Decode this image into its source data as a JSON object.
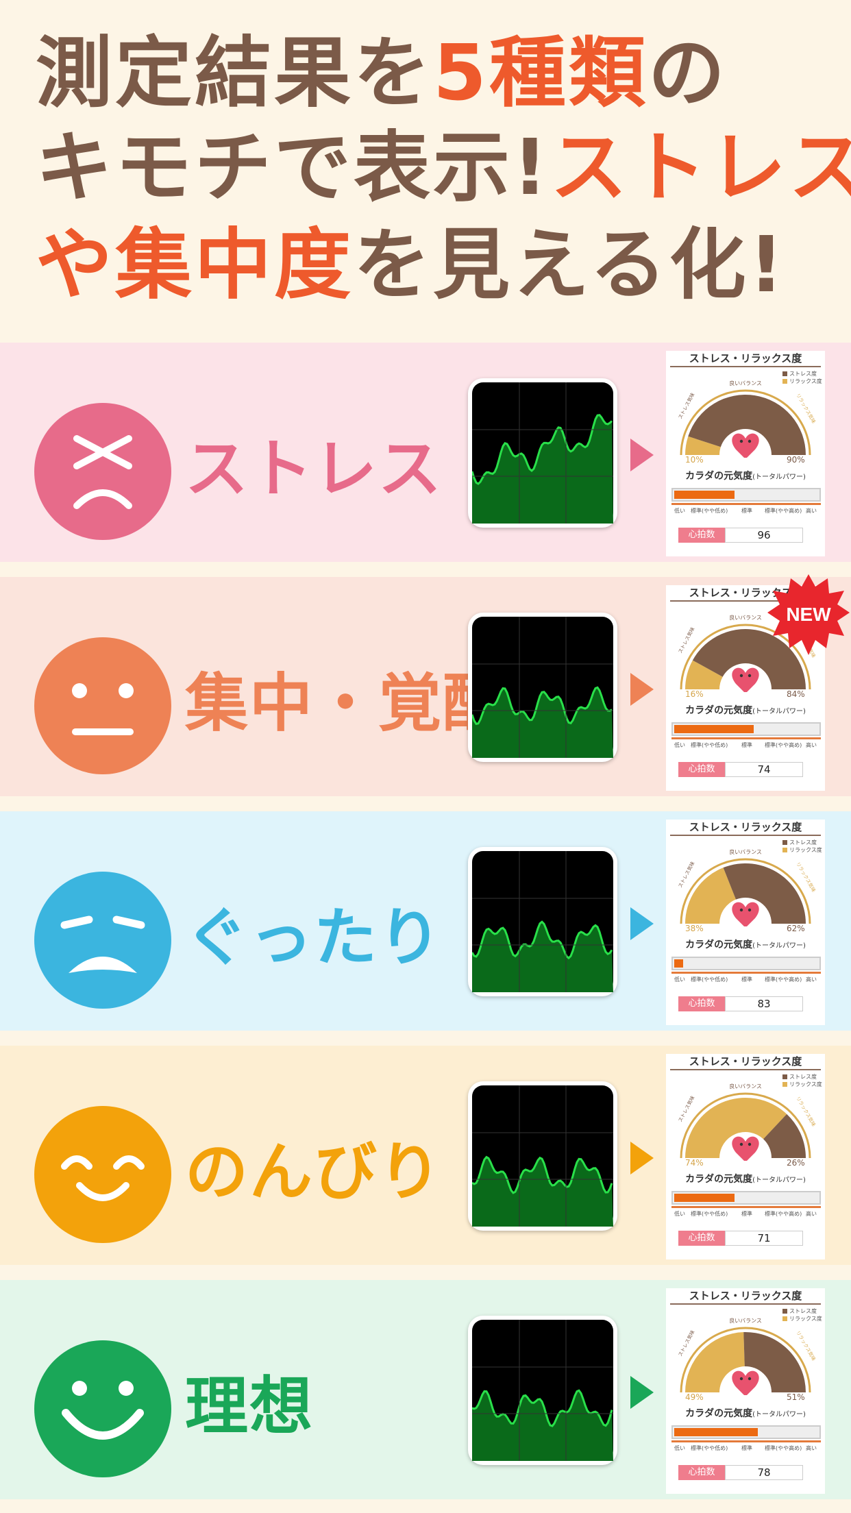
{
  "headline": {
    "line1_a": "測定結果を",
    "line1_b": "5種類",
    "line1_c": "の",
    "line2_a": "キモチで表示!",
    "line2_b": "ストレス",
    "line3_a": "や集中度",
    "line3_b": "を見える化!"
  },
  "report_labels": {
    "stress_title": "ストレス・リラックス度",
    "legend_stress": "ストレス度",
    "legend_relax": "リラックス度",
    "good_balance": "良いバランス",
    "stress_arc": "ストレス気味",
    "relax_arc": "リラックス気味",
    "body_title": "カラダの元気度",
    "body_title_small": "(トータルパワー)",
    "scale_low": "低い",
    "scale_std_low": "標準(やや低め)",
    "scale_std": "標準",
    "scale_std_high": "標準(やや高め)",
    "scale_high": "高い",
    "heart_rate_label": "心拍数"
  },
  "new_badge": "NEW",
  "moods": [
    {
      "label": "ストレス",
      "color": "#e76b8a",
      "bg": "#fce3e8",
      "relax_pct": "10%",
      "stress_pct": "90%",
      "relax": 0.1,
      "power": 0.42,
      "heart_rate": "96"
    },
    {
      "label": "集中・覚醒",
      "color": "#ee8255",
      "bg": "#fbe4dc",
      "relax_pct": "16%",
      "stress_pct": "84%",
      "relax": 0.16,
      "power": 0.55,
      "heart_rate": "74"
    },
    {
      "label": "ぐったり",
      "color": "#3bb5df",
      "bg": "#dff4fb",
      "relax_pct": "38%",
      "stress_pct": "62%",
      "relax": 0.38,
      "power": 0.06,
      "heart_rate": "83"
    },
    {
      "label": "のんびり",
      "color": "#f3a20b",
      "bg": "#fdeed2",
      "relax_pct": "74%",
      "stress_pct": "26%",
      "relax": 0.74,
      "power": 0.42,
      "heart_rate": "71"
    },
    {
      "label": "理想",
      "color": "#1aa758",
      "bg": "#e3f6ea",
      "relax_pct": "49%",
      "stress_pct": "51%",
      "relax": 0.49,
      "power": 0.58,
      "heart_rate": "78"
    }
  ]
}
